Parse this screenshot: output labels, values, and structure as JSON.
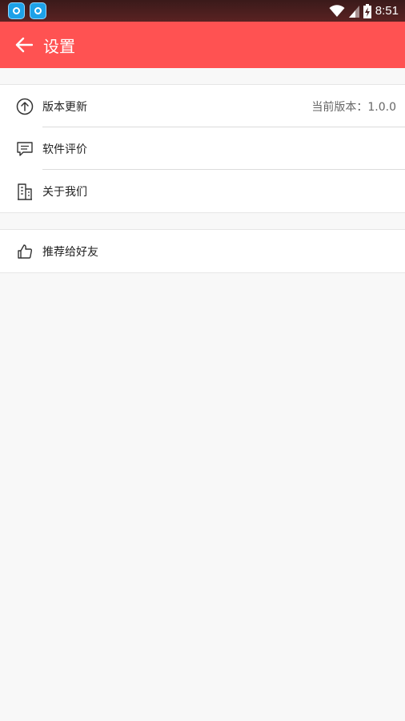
{
  "status_bar": {
    "time": "8:51"
  },
  "app_bar": {
    "title": "设置"
  },
  "settings_group": {
    "items": [
      {
        "label": "版本更新",
        "value": "当前版本：1.0.0",
        "icon": "arrow-up-circle-icon"
      },
      {
        "label": "软件评价",
        "value": "",
        "icon": "message-icon"
      },
      {
        "label": "关于我们",
        "value": "",
        "icon": "building-icon"
      }
    ]
  },
  "share_group": {
    "items": [
      {
        "label": "推荐给好友",
        "icon": "thumbs-up-icon"
      }
    ]
  },
  "colors": {
    "accent": "#ff5252",
    "background": "#f8f8f8"
  }
}
